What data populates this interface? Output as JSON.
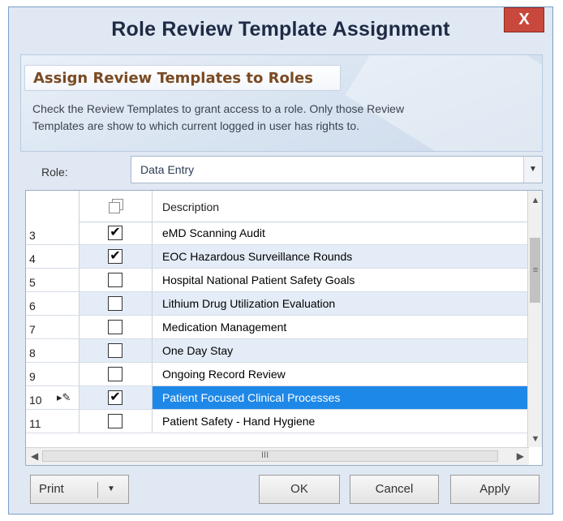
{
  "window": {
    "title": "Role Review Template Assignment",
    "close_label": "X"
  },
  "banner": {
    "title": "Assign Review Templates to Roles",
    "description_line1": "Check the Review Templates to grant access to a role. Only those Review",
    "description_line2": "Templates are show to which current logged in user has rights to."
  },
  "role": {
    "label": "Role:",
    "value": "Data Entry"
  },
  "grid": {
    "header_description": "Description",
    "rows": [
      {
        "num": "3",
        "checked": true,
        "description": "eMD Scanning Audit",
        "selected": false
      },
      {
        "num": "4",
        "checked": true,
        "description": "EOC Hazardous Surveillance Rounds",
        "selected": false
      },
      {
        "num": "5",
        "checked": false,
        "description": "Hospital National Patient Safety Goals",
        "selected": false
      },
      {
        "num": "6",
        "checked": false,
        "description": "Lithium Drug Utilization Evaluation",
        "selected": false
      },
      {
        "num": "7",
        "checked": false,
        "description": "Medication Management",
        "selected": false
      },
      {
        "num": "8",
        "checked": false,
        "description": "One Day Stay",
        "selected": false
      },
      {
        "num": "9",
        "checked": false,
        "description": "Ongoing Record Review",
        "selected": false
      },
      {
        "num": "10",
        "checked": true,
        "description": "Patient Focused Clinical Processes",
        "selected": true
      },
      {
        "num": "11",
        "checked": false,
        "description": "Patient Safety - Hand Hygiene",
        "selected": false
      }
    ]
  },
  "buttons": {
    "print": "Print",
    "ok": "OK",
    "cancel": "Cancel",
    "apply": "Apply"
  },
  "colors": {
    "selection": "#1e88e8",
    "close": "#c9483d",
    "alt_row": "#e4ecf7"
  }
}
